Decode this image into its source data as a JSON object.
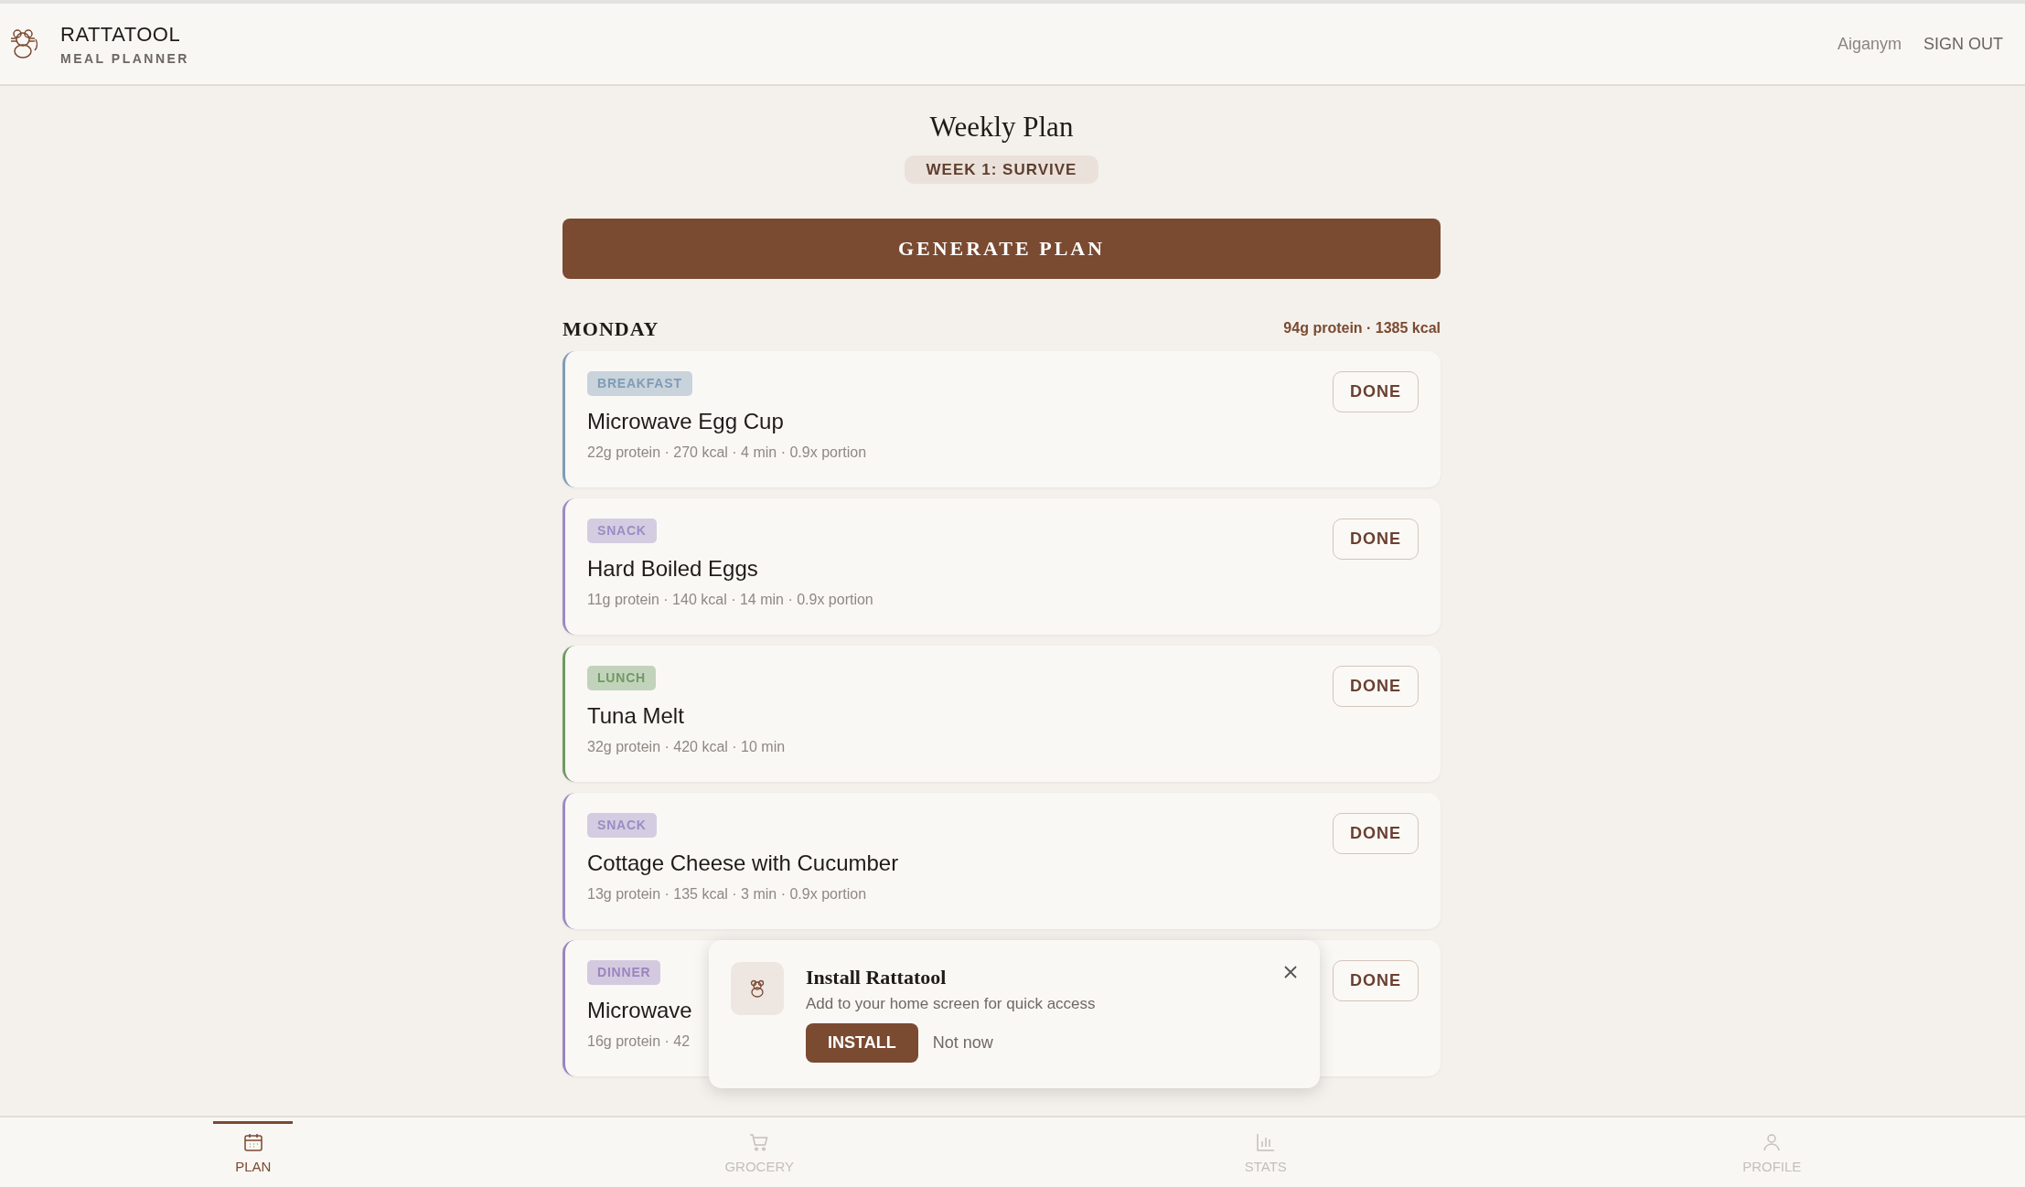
{
  "header": {
    "title": "RATTATOOL",
    "subtitle": "MEAL PLANNER",
    "user": "Aiganym",
    "sign_out": "SIGN OUT"
  },
  "page": {
    "title": "Weekly Plan",
    "week_badge": "WEEK 1: SURVIVE",
    "generate_button": "GENERATE PLAN"
  },
  "day": {
    "name": "MONDAY",
    "totals": "94g protein · 1385 kcal",
    "meals": [
      {
        "tag": "BREAKFAST",
        "color": "#7f9cb6",
        "title": "Microwave Egg Cup",
        "meta": "22g protein · 270 kcal · 4 min · 0.9x portion",
        "button": "DONE"
      },
      {
        "tag": "SNACK",
        "color": "#9a8cc4",
        "title": "Hard Boiled Eggs",
        "meta": "11g protein · 140 kcal · 14 min · 0.9x portion",
        "button": "DONE"
      },
      {
        "tag": "LUNCH",
        "color": "#6f9a63",
        "title": "Tuna Melt",
        "meta": "32g protein · 420 kcal · 10 min",
        "button": "DONE"
      },
      {
        "tag": "SNACK",
        "color": "#9a8cc4",
        "title": "Cottage Cheese with Cucumber",
        "meta": "13g protein · 135 kcal · 3 min · 0.9x portion",
        "button": "DONE"
      },
      {
        "tag": "DINNER",
        "color": "#9b84c0",
        "title": "Microwave",
        "meta": "16g protein · 42",
        "button": "DONE"
      }
    ]
  },
  "install_prompt": {
    "title": "Install Rattatool",
    "text": "Add to your home screen for quick access",
    "install": "INSTALL",
    "dismiss": "Not now"
  },
  "bottom_nav": [
    {
      "kind": "plan",
      "label": "PLAN",
      "selected": true
    },
    {
      "kind": "grocery",
      "label": "GROCERY",
      "selected": false
    },
    {
      "kind": "stats",
      "label": "STATS",
      "selected": false
    },
    {
      "kind": "profile",
      "label": "PROFILE",
      "selected": false
    }
  ]
}
